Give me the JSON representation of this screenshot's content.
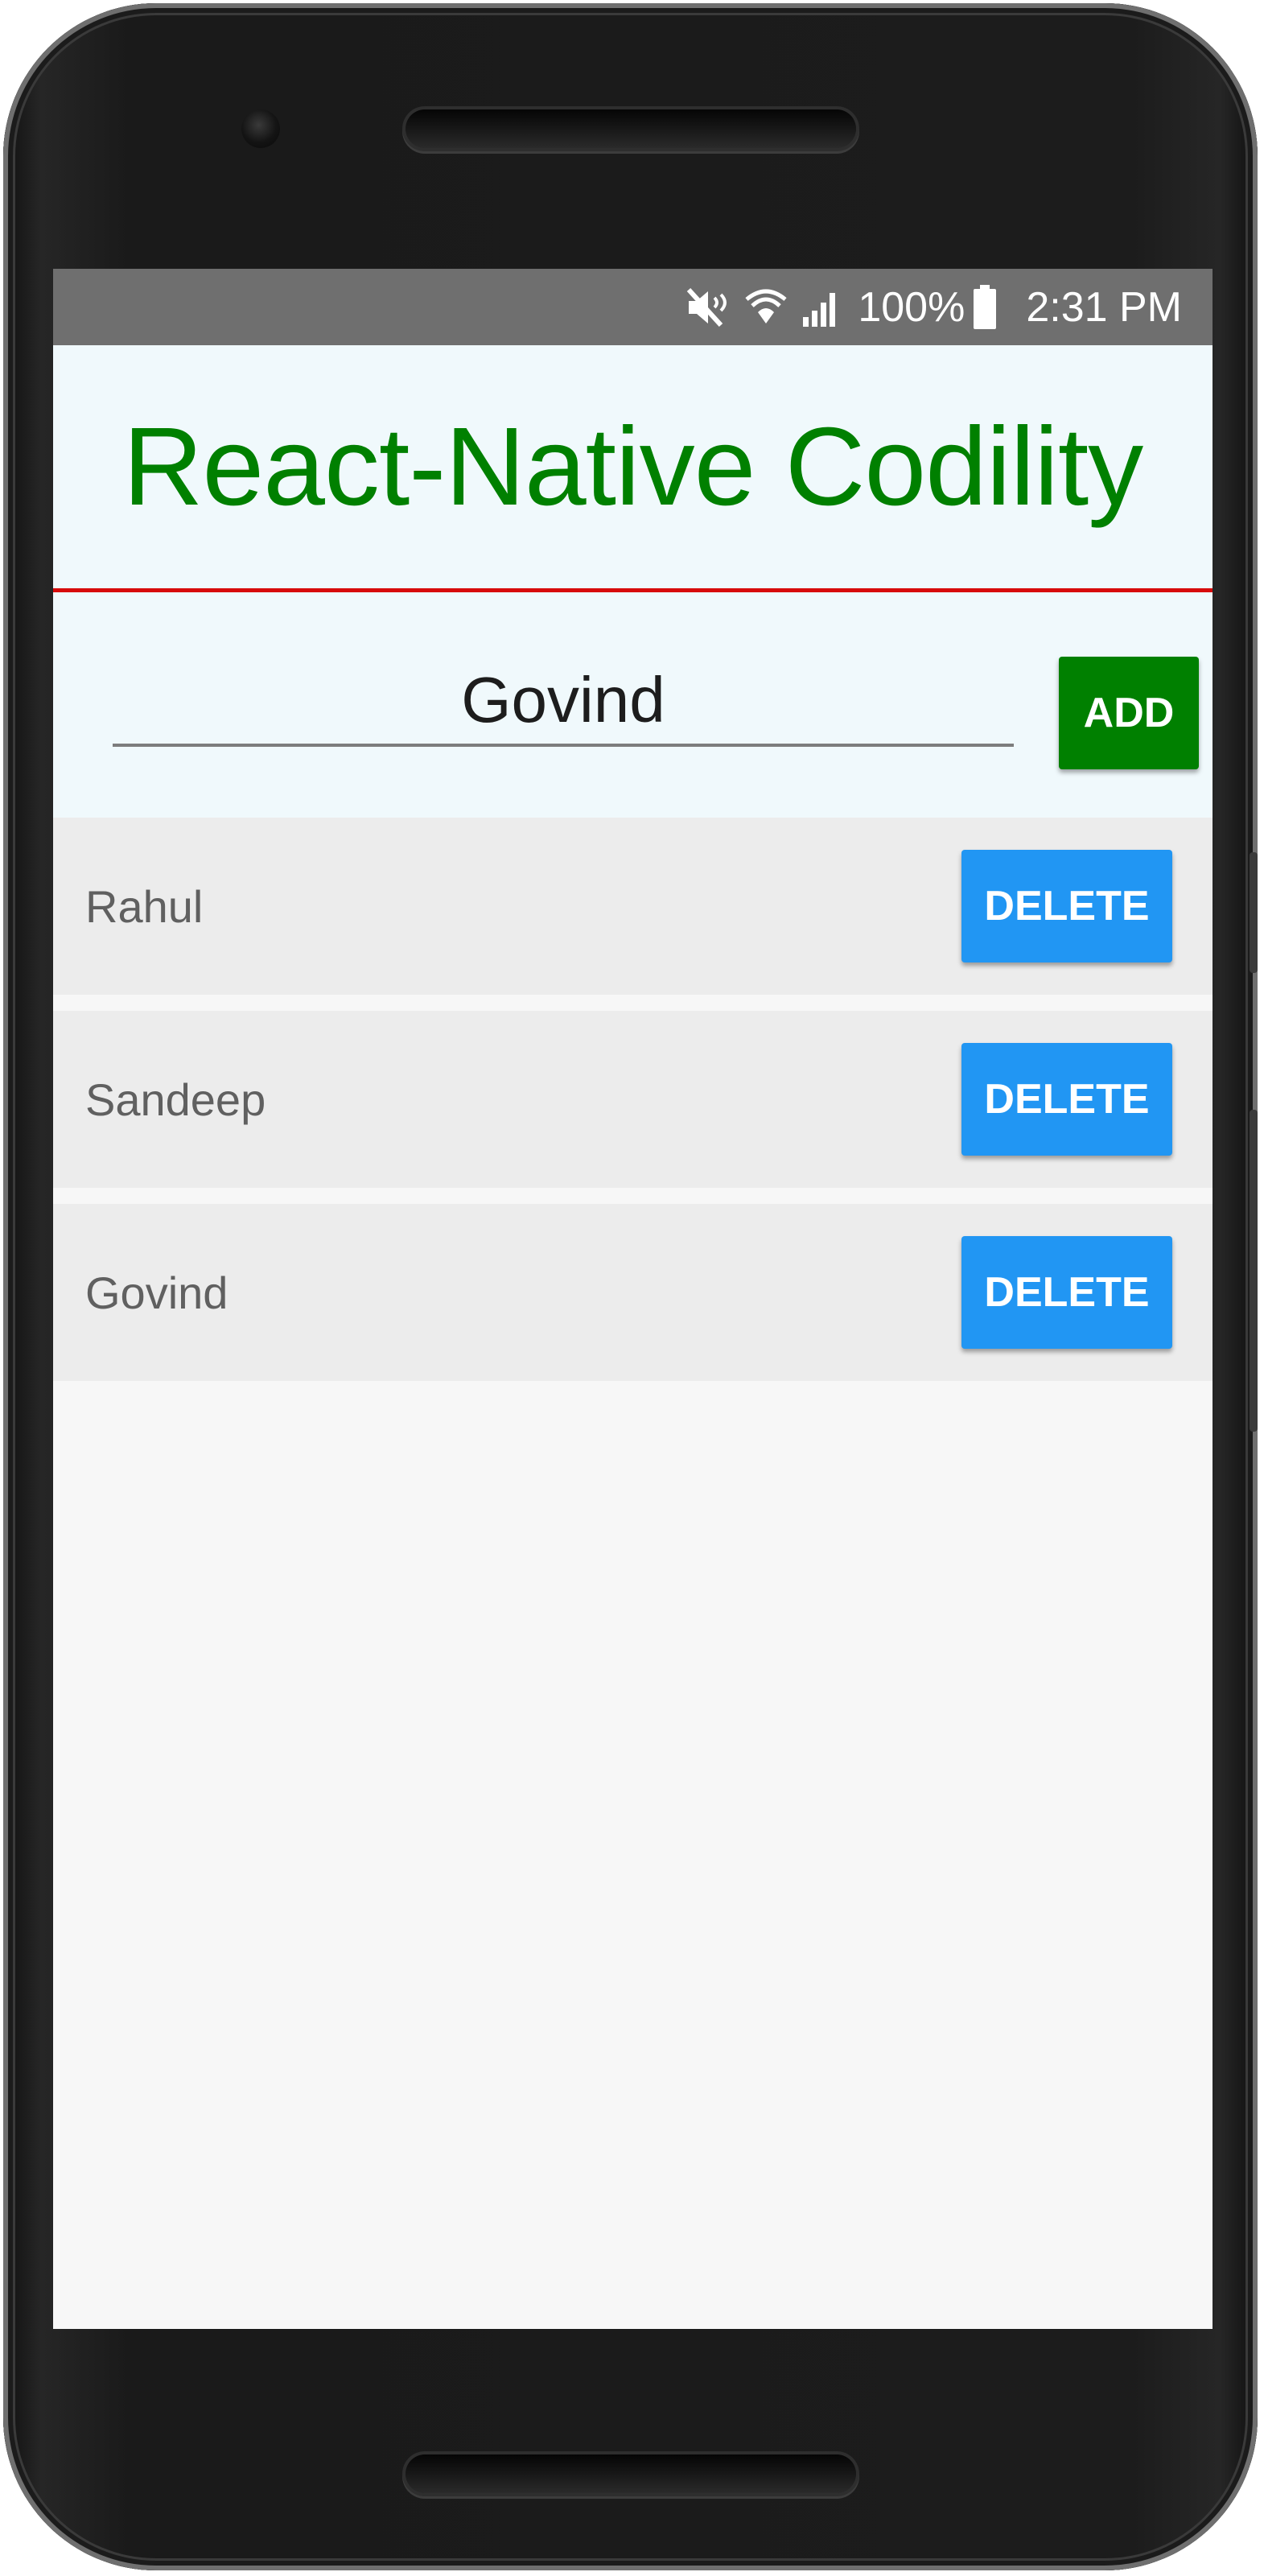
{
  "status_bar": {
    "battery_level": "100%",
    "time": "2:31 PM",
    "icons": [
      "mute-icon",
      "wifi-icon",
      "signal-icon",
      "battery-icon"
    ]
  },
  "header": {
    "title": "React-Native Codility",
    "title_color": "#008000",
    "divider_color": "#d70b0b"
  },
  "input": {
    "value": "Govind",
    "add_label": "ADD",
    "add_color": "#008000"
  },
  "list": {
    "items": [
      {
        "name": "Rahul",
        "action": "DELETE"
      },
      {
        "name": "Sandeep",
        "action": "DELETE"
      },
      {
        "name": "Govind",
        "action": "DELETE"
      }
    ],
    "delete_color": "#2196f3"
  }
}
